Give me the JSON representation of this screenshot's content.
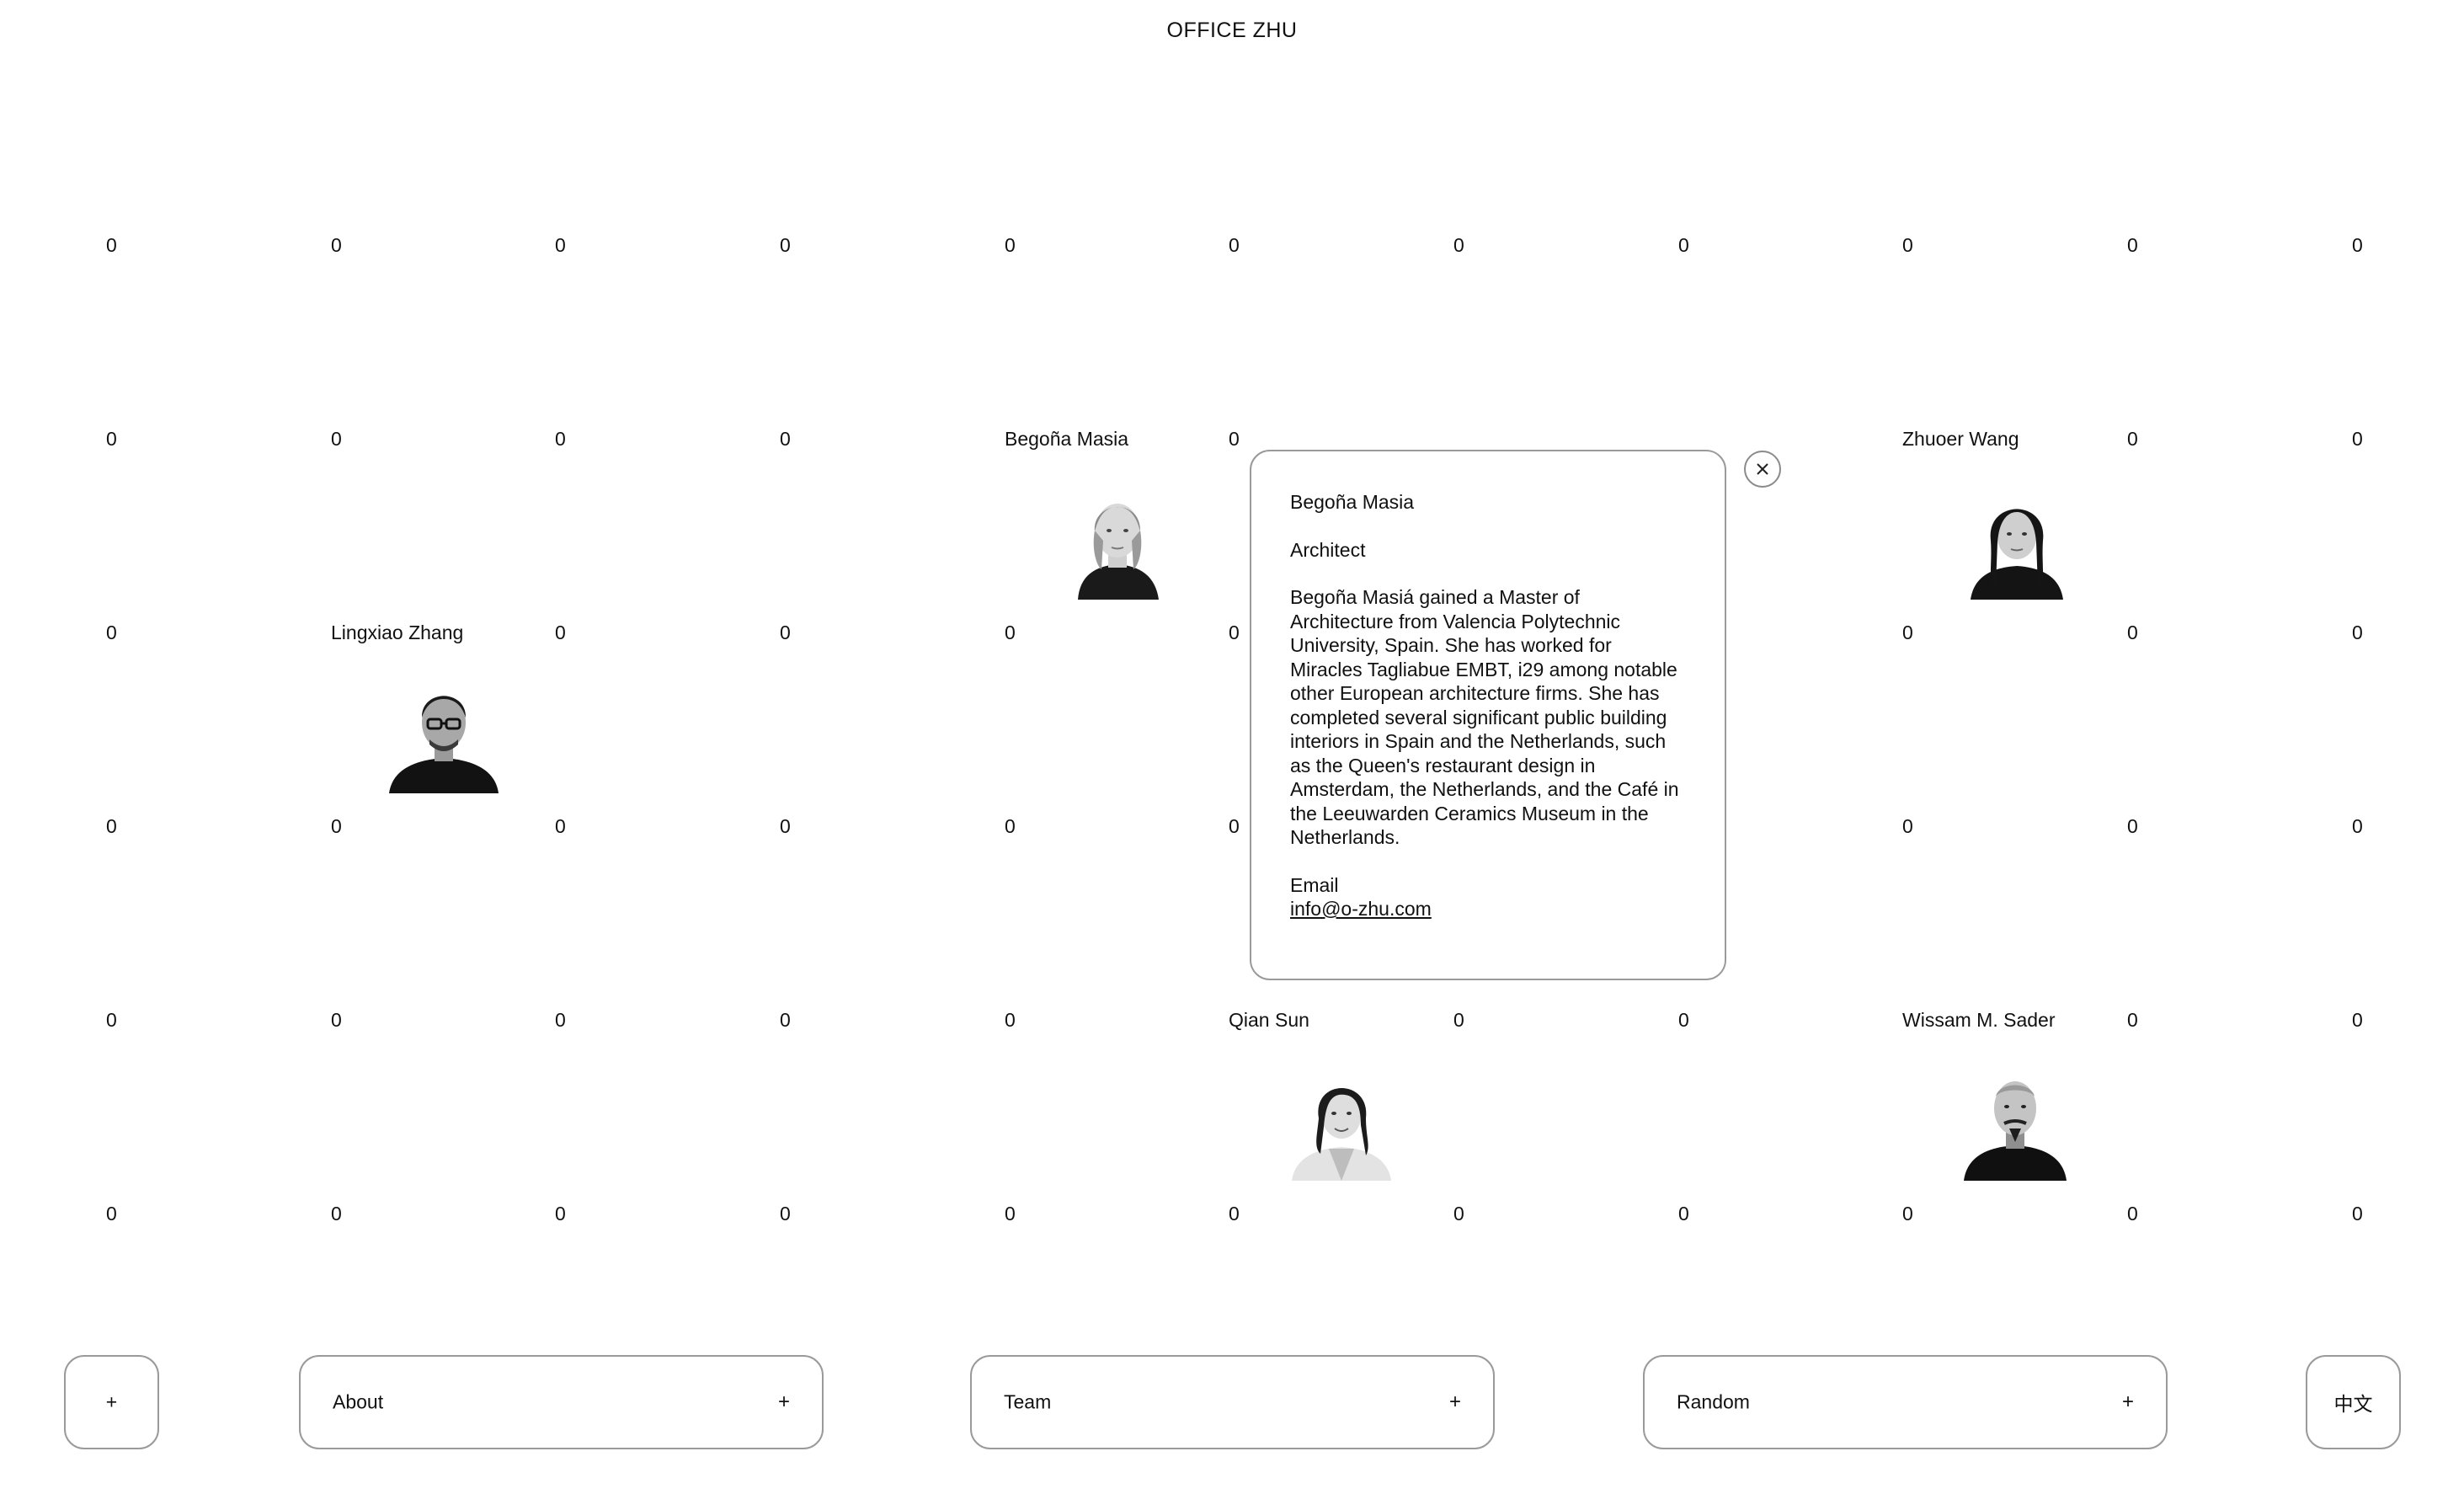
{
  "site_title": "OFFICE ZHU",
  "grid": {
    "default_value": "0",
    "rows": 6,
    "cols": 11
  },
  "people": [
    {
      "key": "begona",
      "name": "Begoña Masia",
      "row": 1,
      "col": 4
    },
    {
      "key": "zhuoer",
      "name": "Zhuoer Wang",
      "row": 1,
      "col": 8
    },
    {
      "key": "lingxiao",
      "name": "Lingxiao Zhang",
      "row": 2,
      "col": 1
    },
    {
      "key": "qian",
      "name": "Qian Sun",
      "row": 4,
      "col": 5
    },
    {
      "key": "wissam",
      "name": "Wissam M. Sader",
      "row": 4,
      "col": 8
    }
  ],
  "hidden_cells": [
    {
      "row": 1,
      "col": 6
    },
    {
      "row": 1,
      "col": 7
    },
    {
      "row": 2,
      "col": 6
    },
    {
      "row": 2,
      "col": 7
    },
    {
      "row": 3,
      "col": 6
    },
    {
      "row": 3,
      "col": 7
    }
  ],
  "popup": {
    "name": "Begoña Masia",
    "role": "Architect",
    "bio": "Begoña Masiá gained a Master of Architecture from Valencia Polytechnic University, Spain. She has worked for Miracles Tagliabue EMBT, i29 among notable other European architecture firms. She has completed several significant public building interiors in Spain and the Netherlands, such as the Queen's restaurant design in Amsterdam, the Netherlands, and the Café in the Leeuwarden Ceramics Museum in the Netherlands.",
    "email_label": "Email",
    "email": "info@o-zhu.com",
    "close_icon": "close-icon"
  },
  "nav": {
    "plus_only": "+",
    "about": {
      "label": "About",
      "icon": "+"
    },
    "team": {
      "label": "Team",
      "icon": "+"
    },
    "random": {
      "label": "Random",
      "icon": "+"
    },
    "language": "中文"
  }
}
